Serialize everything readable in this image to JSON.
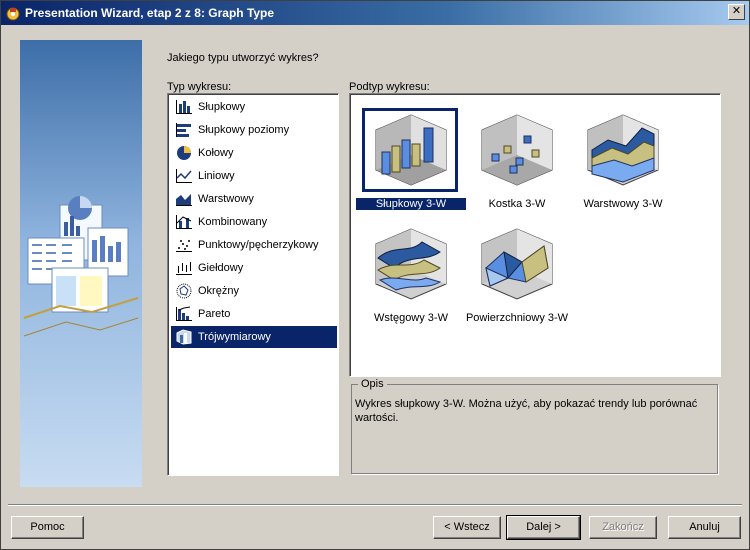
{
  "window": {
    "title": "Presentation Wizard, etap 2 z 8: Graph Type",
    "close_label": "✕"
  },
  "question": "Jakiego typu utworzyć wykres?",
  "type_list": {
    "label": "Typ wykresu:",
    "items": [
      {
        "label": "Słupkowy",
        "icon": "bar-chart-icon"
      },
      {
        "label": "Słupkowy poziomy",
        "icon": "horizontal-bar-icon"
      },
      {
        "label": "Kołowy",
        "icon": "pie-chart-icon"
      },
      {
        "label": "Liniowy",
        "icon": "line-chart-icon"
      },
      {
        "label": "Warstwowy",
        "icon": "area-chart-icon"
      },
      {
        "label": "Kombinowany",
        "icon": "combo-chart-icon"
      },
      {
        "label": "Punktowy/pęcherzykowy",
        "icon": "scatter-chart-icon"
      },
      {
        "label": "Giełdowy",
        "icon": "stock-chart-icon"
      },
      {
        "label": "Okrężny",
        "icon": "radar-chart-icon"
      },
      {
        "label": "Pareto",
        "icon": "pareto-chart-icon"
      },
      {
        "label": "Trójwymiarowy",
        "icon": "3d-chart-icon"
      }
    ],
    "selected_index": 10
  },
  "subtype": {
    "label": "Podtyp wykresu:",
    "items": [
      {
        "label": "Słupkowy 3-W",
        "icon": "3d-bar-icon"
      },
      {
        "label": "Kostka 3-W",
        "icon": "3d-cube-icon"
      },
      {
        "label": "Warstwowy 3-W",
        "icon": "3d-area-icon"
      },
      {
        "label": "Wstęgowy 3-W",
        "icon": "3d-ribbon-icon"
      },
      {
        "label": "Powierzchniowy 3-W",
        "icon": "3d-surface-icon"
      }
    ],
    "selected_index": 0
  },
  "description": {
    "legend": "Opis",
    "text": "Wykres słupkowy 3-W. Można użyć, aby pokazać trendy lub porównać wartości."
  },
  "buttons": {
    "help": "Pomoc",
    "back": "< Wstecz",
    "next": "Dalej >",
    "finish": "Zakończ",
    "cancel": "Anuluj"
  },
  "colors": {
    "selection": "#0a246a",
    "dialog_bg": "#d4d0c8"
  }
}
